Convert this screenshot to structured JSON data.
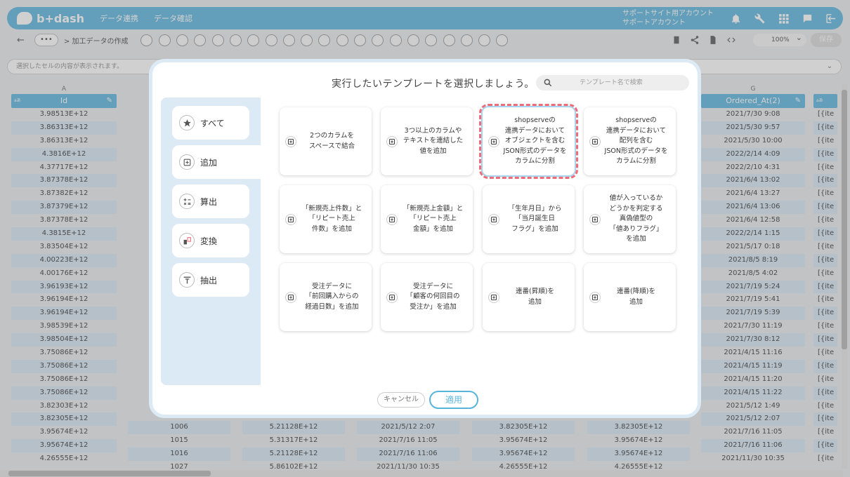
{
  "header": {
    "logo": "b+dash",
    "nav": [
      "データ連携",
      "データ確認"
    ],
    "account_line1": "サポートサイト用アカウント",
    "account_line2": "サポートアカウント"
  },
  "toolbar": {
    "more": "•••",
    "breadcrumb": "> 加工データの作成",
    "zoom": "100%",
    "save": "保存"
  },
  "cellbar": {
    "placeholder": "選択したセルの内容が表示されます。"
  },
  "sheet": {
    "colA": {
      "letter": "A",
      "header": "Id",
      "cells": [
        "3.98513E+12",
        "3.86313E+12",
        "3.86313E+12",
        "4.3816E+12",
        "4.37717E+12",
        "3.87378E+12",
        "3.87382E+12",
        "3.87379E+12",
        "3.87378E+12",
        "4.3815E+12",
        "3.83504E+12",
        "4.00223E+12",
        "4.00176E+12",
        "3.96193E+12",
        "3.96194E+12",
        "3.96194E+12",
        "3.98539E+12",
        "3.98504E+12",
        "3.75086E+12",
        "3.75086E+12",
        "3.75086E+12",
        "3.75086E+12",
        "3.82303E+12",
        "3.82305E+12",
        "3.95674E+12",
        "3.95674E+12",
        "4.26555E+12"
      ]
    },
    "colG": {
      "letter": "G",
      "header": "Ordered_At(2)",
      "cells": [
        "2021/7/30 9:08",
        "2021/5/30 9:57",
        "2021/5/30 10:00",
        "2022/2/14 4:09",
        "2022/2/10 4:31",
        "2021/6/4 13:02",
        "2021/6/4 13:27",
        "2021/6/4 13:06",
        "2021/6/4 12:58",
        "2022/2/14 1:15",
        "2021/5/17 0:18",
        "2021/8/5 8:19",
        "2021/8/5 4:02",
        "2021/7/19 5:24",
        "2021/7/19 5:41",
        "2021/7/19 5:39",
        "2021/7/30 11:19",
        "2021/7/30 8:12",
        "2021/4/15 11:16",
        "2021/4/15 11:19",
        "2021/4/15 11:20",
        "2021/4/15 11:22",
        "2021/5/12 1:49",
        "2021/5/12 2:07",
        "2021/7/16 11:05",
        "2021/7/16 11:06",
        "2021/11/30 10:35"
      ]
    },
    "colH_text": "[{ite",
    "bottom_rows": [
      [
        "1006",
        "5.21128E+12",
        "2021/5/12 2:07",
        "3.82305E+12",
        "3.82305E+12"
      ],
      [
        "1015",
        "5.31317E+12",
        "2021/7/16 11:05",
        "3.95674E+12",
        "3.95674E+12"
      ],
      [
        "1016",
        "5.21128E+12",
        "2021/7/16 11:06",
        "3.95674E+12",
        "3.95674E+12"
      ],
      [
        "1027",
        "5.86102E+12",
        "2021/11/30 10:35",
        "4.26555E+12",
        "4.26555E+12"
      ]
    ]
  },
  "modal": {
    "title": "実行したいテンプレートを選択しましょう。",
    "search_placeholder": "テンプレート名で検索",
    "tabs": [
      {
        "label": "すべて",
        "icon": "star-icon"
      },
      {
        "label": "追加",
        "icon": "plus-square-icon"
      },
      {
        "label": "算出",
        "icon": "calculator-icon"
      },
      {
        "label": "変換",
        "icon": "convert-icon"
      },
      {
        "label": "抽出",
        "icon": "filter-icon"
      }
    ],
    "cards": [
      "2つのカラムを\nスペースで結合",
      "3つ以上のカラムや\nテキストを連結した\n値を追加",
      "shopserveの\n連携データにおいて\nオブジェクトを含む\nJSON形式のデータを\nカラムに分割",
      "shopserveの\n連携データにおいて\n配列を含む\nJSON形式のデータを\nカラムに分割",
      "「新規売上件数」と\n「リピート売上\n件数」を追加",
      "「新規売上金額」と\n「リピート売上\n金額」を追加",
      "「生年月日」から\n「当月誕生日\nフラグ」を追加",
      "値が入っているか\nどうかを判定する\n真偽値型の\n「値ありフラグ」\nを追加",
      "受注データに\n「前回購入からの\n経過日数」を追加",
      "受注データに\n「顧客の何回目の\n受注か」を追加",
      "連番(昇順)を\n追加",
      "連番(降順)を\n追加"
    ],
    "cancel": "キャンセル",
    "apply": "適用"
  },
  "colors": {
    "accent": "#58b4dd",
    "selection": "#ee6c77",
    "panel": "#dceaf5"
  }
}
